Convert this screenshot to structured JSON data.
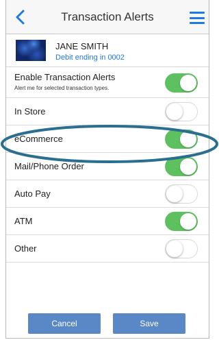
{
  "header": {
    "title": "Transaction Alerts"
  },
  "account": {
    "name": "JANE SMITH",
    "subtitle": "Debit ending in 0002"
  },
  "settings": {
    "rows": [
      {
        "label": "Enable Transaction Alerts",
        "sub": "Alert me for selected transaction types.",
        "on": true
      },
      {
        "label": "In Store",
        "on": false
      },
      {
        "label": "eCommerce",
        "on": true
      },
      {
        "label": "Mail/Phone Order",
        "on": true
      },
      {
        "label": "Auto Pay",
        "on": false
      },
      {
        "label": "ATM",
        "on": true
      },
      {
        "label": "Other",
        "on": false
      }
    ]
  },
  "footer": {
    "cancel_label": "Cancel",
    "save_label": "Save"
  },
  "colors": {
    "accent": "#1f7ae0",
    "toggle_on": "#5cc15e",
    "button": "#5a87c5",
    "highlight": "#2a6f8f"
  }
}
